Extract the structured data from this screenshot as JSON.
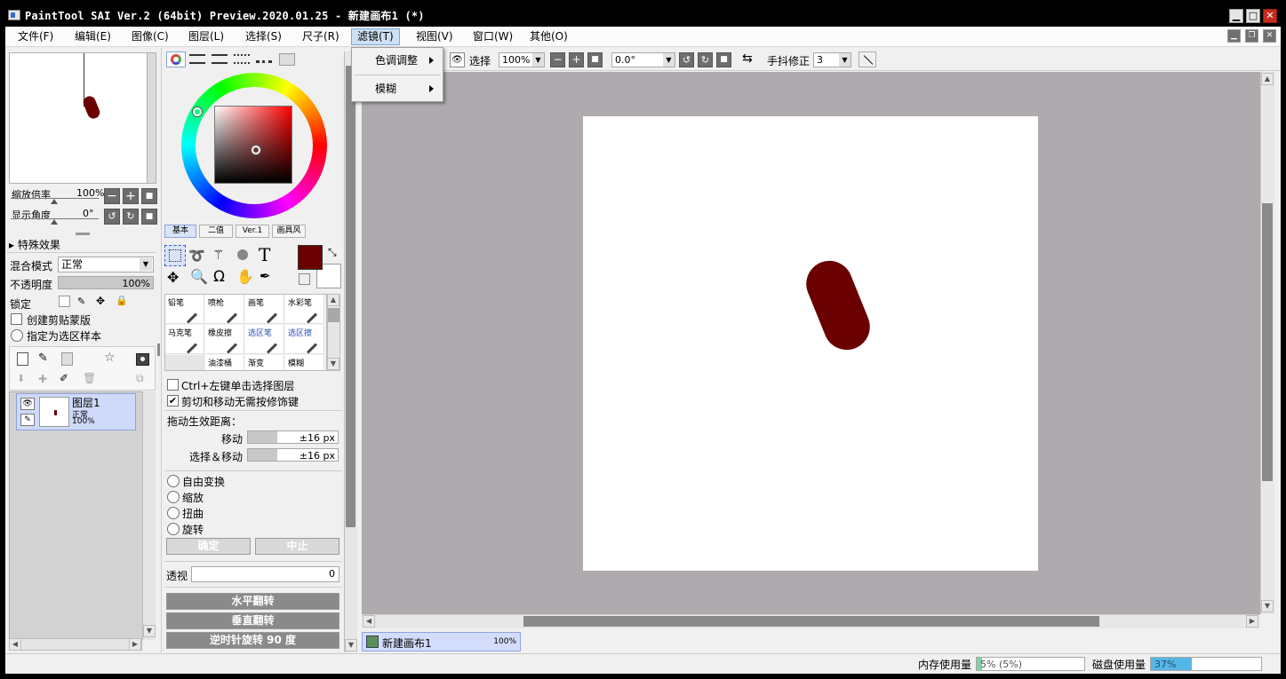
{
  "window": {
    "title": "PaintTool SAI Ver.2 (64bit) Preview.2020.01.25 - 新建画布1 (*)"
  },
  "menubar": {
    "items": [
      "文件(F)",
      "编辑(E)",
      "图像(C)",
      "图层(L)",
      "选择(S)",
      "尺子(R)",
      "滤镜(T)",
      "视图(V)",
      "窗口(W)",
      "其他(O)"
    ],
    "active": "滤镜(T)"
  },
  "filter_menu": {
    "items": [
      "色调调整",
      "模糊"
    ]
  },
  "toolbar": {
    "select_label": "选择",
    "zoom_value": "100%",
    "angle_value": "0.0°",
    "stabilizer_label": "手抖修正",
    "stabilizer_value": "3"
  },
  "navigator": {
    "zoom_label": "缩放倍率",
    "zoom_value": "100%",
    "angle_label": "显示角度",
    "angle_value": "0°"
  },
  "layer_panel": {
    "effects_header": "特殊效果",
    "blend_label": "混合模式",
    "blend_value": "正常",
    "opacity_label": "不透明度",
    "opacity_value": "100%",
    "lock_label": "锁定",
    "clip_label": "创建剪贴蒙版",
    "sample_label": "指定为选区样本",
    "layer": {
      "name": "图层1",
      "mode": "正常",
      "opacity": "100%"
    }
  },
  "color_panel": {
    "tabs": [
      "基本",
      "二值",
      "Ver.1",
      "画具风"
    ],
    "fg_color": "#6b0000",
    "bg_color": "#ffffff"
  },
  "brush_tools": [
    [
      "铅笔",
      "喷枪",
      "画笔",
      "水彩笔"
    ],
    [
      "马克笔",
      "橡皮擦",
      "选区笔",
      "选区擦"
    ],
    [
      "",
      "油漆桶",
      "渐变",
      "模糊"
    ]
  ],
  "transform_panel": {
    "ctrl_click_label": "Ctrl+左键单击选择图层",
    "cut_move_label": "剪切和移动无需按修饰键",
    "drag_distance_label": "拖动生效距离：",
    "move_label": "移动",
    "move_value": "±16 px",
    "select_move_label": "选择＆移动",
    "select_move_value": "±16 px",
    "free_transform": "自由变换",
    "scale": "缩放",
    "distort": "扭曲",
    "rotate": "旋转",
    "ok": "确定",
    "cancel": "中止",
    "perspective_label": "透视",
    "perspective_value": "0",
    "flip_h": "水平翻转",
    "flip_v": "垂直翻转",
    "rotate_ccw": "逆时针旋转 90 度"
  },
  "canvas": {
    "tab_name": "新建画布1",
    "tab_zoom": "100%",
    "stroke_color": "#6b0000"
  },
  "status": {
    "memory_label": "内存使用量",
    "memory_value": "5% (5%)",
    "memory_fraction": 0.05,
    "disk_label": "磁盘使用量",
    "disk_value": "37%",
    "disk_fraction": 0.37
  }
}
